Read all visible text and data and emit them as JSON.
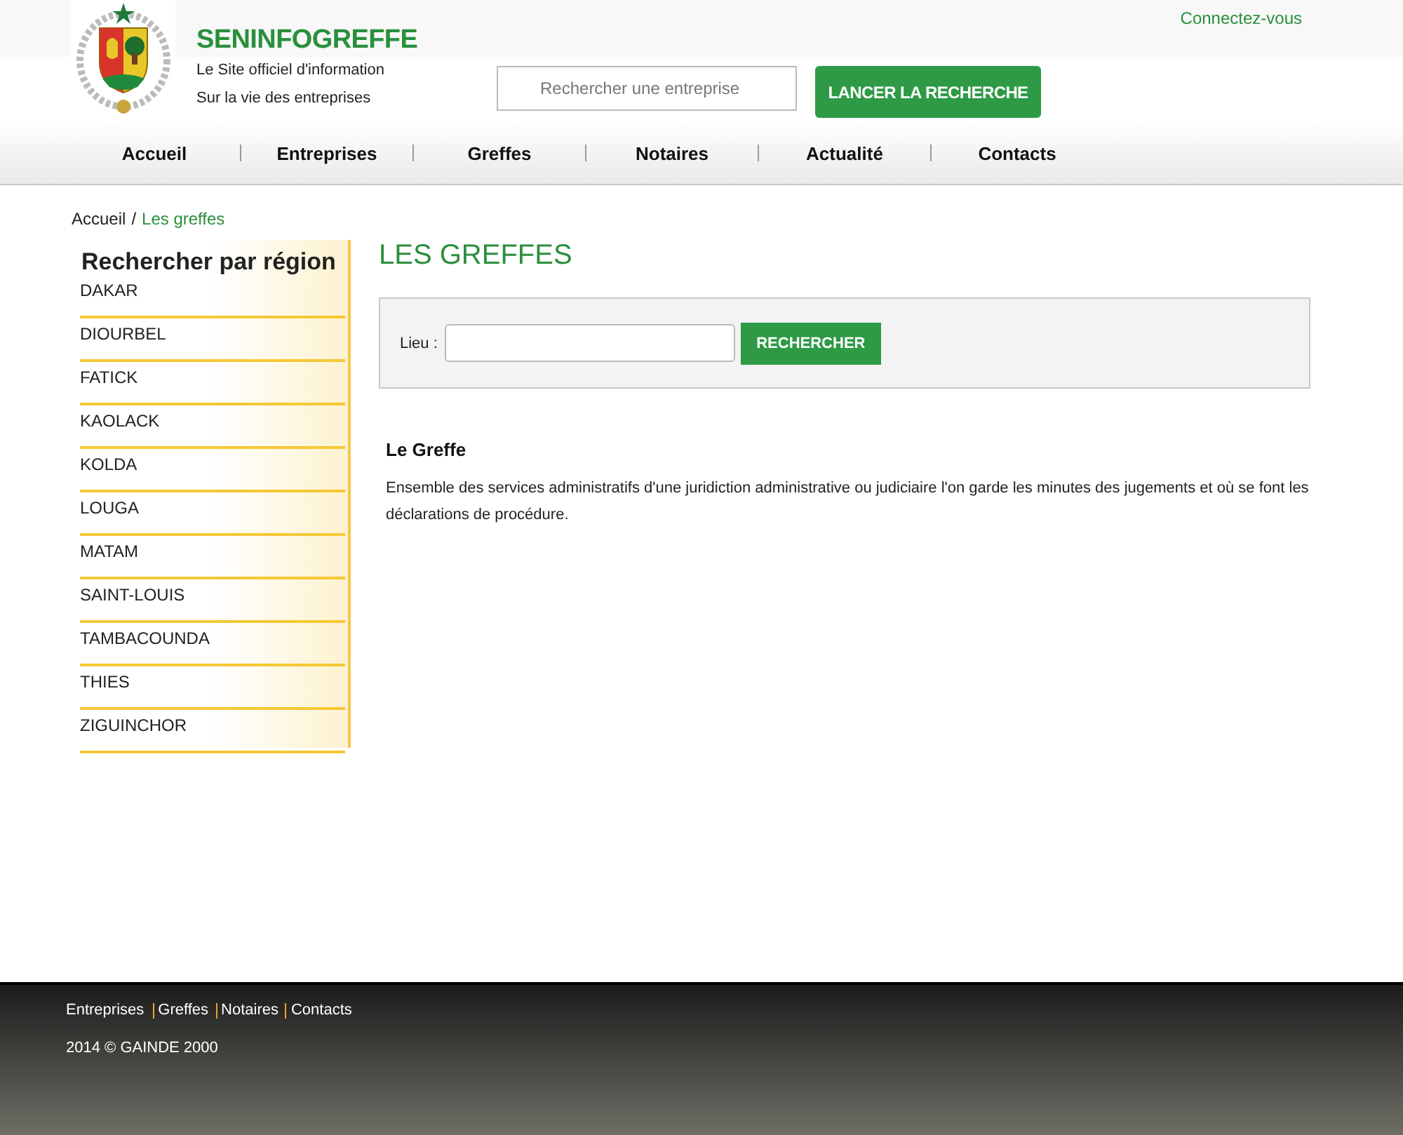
{
  "header": {
    "site_name": "SENINFOGREFFE",
    "tagline": [
      "Le Site officiel d'information",
      "Sur la vie des entreprises"
    ],
    "login_link": "Connectez-vous",
    "search": {
      "placeholder": "Rechercher une entreprise"
    },
    "search_button": "LANCER LA RECHERCHE"
  },
  "nav": [
    "Accueil",
    "Entreprises",
    "Greffes",
    "Notaires",
    "Actualité",
    "Contacts"
  ],
  "breadcrumb_separator": "/",
  "breadcrumb": [
    {
      "label": "Accueil",
      "current": false
    },
    {
      "label": "Les greffes",
      "current": true
    }
  ],
  "sidebar": {
    "title": "Rechercher par région",
    "regions": [
      "DAKAR",
      "DIOURBEL",
      "FATICK",
      "KAOLACK",
      "KOLDA",
      "LOUGA",
      "MATAM",
      "SAINT-LOUIS",
      "TAMBACOUNDA",
      "THIES",
      "ZIGUINCHOR"
    ]
  },
  "main": {
    "title": "LES GREFFES",
    "search": {
      "label": "Lieu :",
      "button": "RECHERCHER"
    },
    "section": {
      "title": "Le Greffe",
      "text": "Ensemble des services administratifs d'une juridiction administrative ou judiciaire l'on garde les minutes des jugements et où se font les déclarations de procédure."
    }
  },
  "footer": {
    "links": [
      "Entreprises",
      "Greffes",
      "Notaires",
      "Contacts"
    ],
    "copyright": "2014 © GAINDE 2000"
  }
}
